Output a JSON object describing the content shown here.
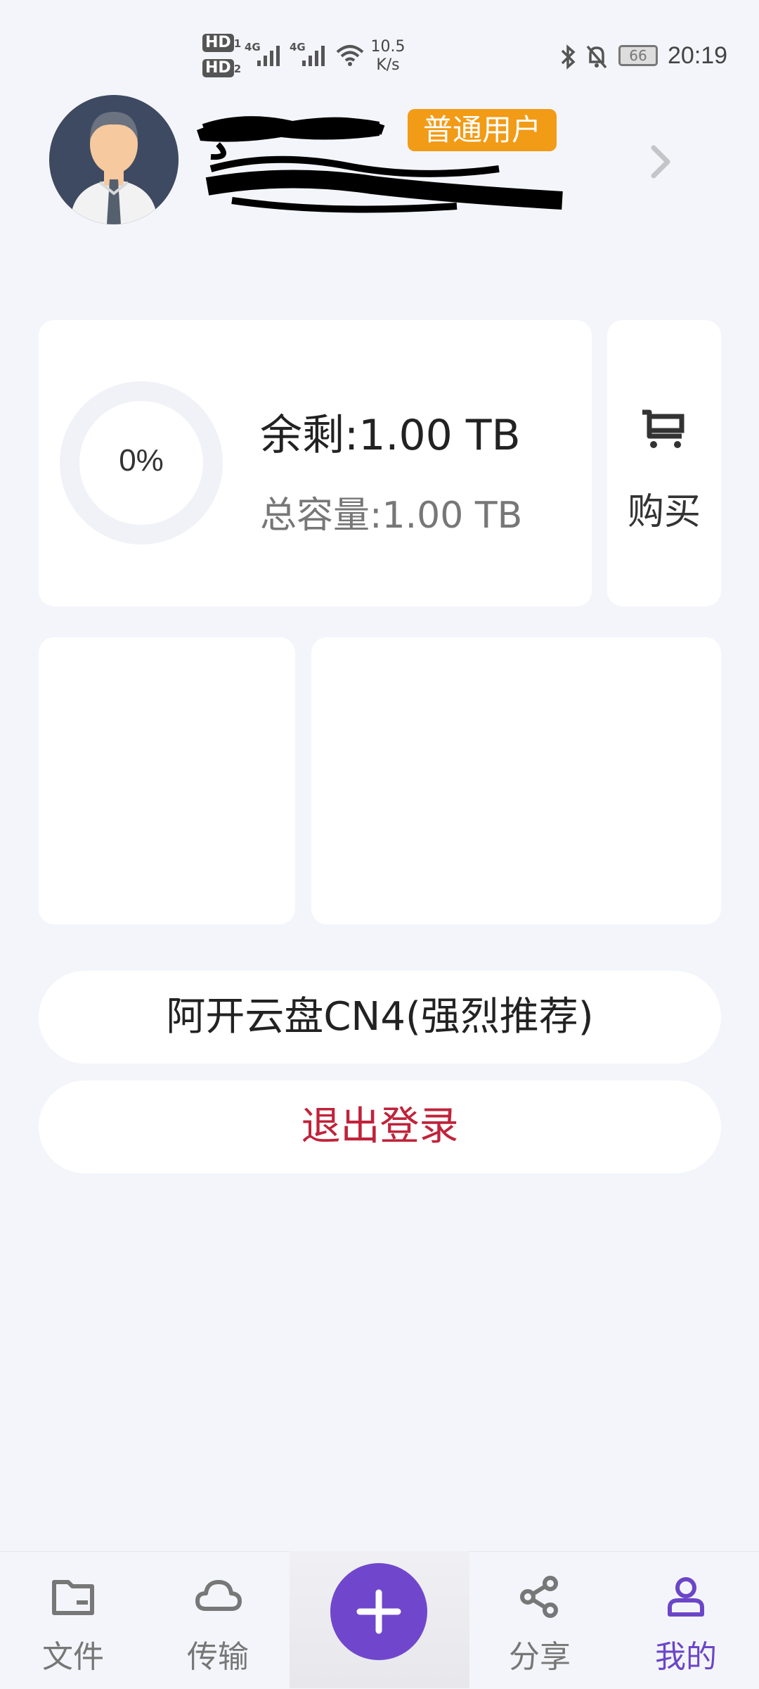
{
  "status_bar": {
    "sim1": "HD",
    "sim1_index": "1",
    "sim2": "HD",
    "sim2_index": "2",
    "net1": "4G",
    "net2": "4G",
    "speed_value": "10.5",
    "speed_unit": "K/s",
    "battery": "66",
    "time": "20:19"
  },
  "profile": {
    "badge": "普通用户"
  },
  "storage": {
    "percent": "0%",
    "used_fraction": 0,
    "remaining": "余剩:1.00 TB",
    "total": "总容量:1.00 TB"
  },
  "buy": {
    "label": "购买"
  },
  "actions": {
    "recommend": "阿开云盘CN4(强烈推荐)",
    "logout": "退出登录"
  },
  "nav": {
    "files": "文件",
    "transfer": "传输",
    "share": "分享",
    "mine": "我的"
  },
  "colors": {
    "accent": "#7047cc",
    "badge": "#f29b16",
    "logout": "#c0233a",
    "background": "#f4f5fa"
  }
}
